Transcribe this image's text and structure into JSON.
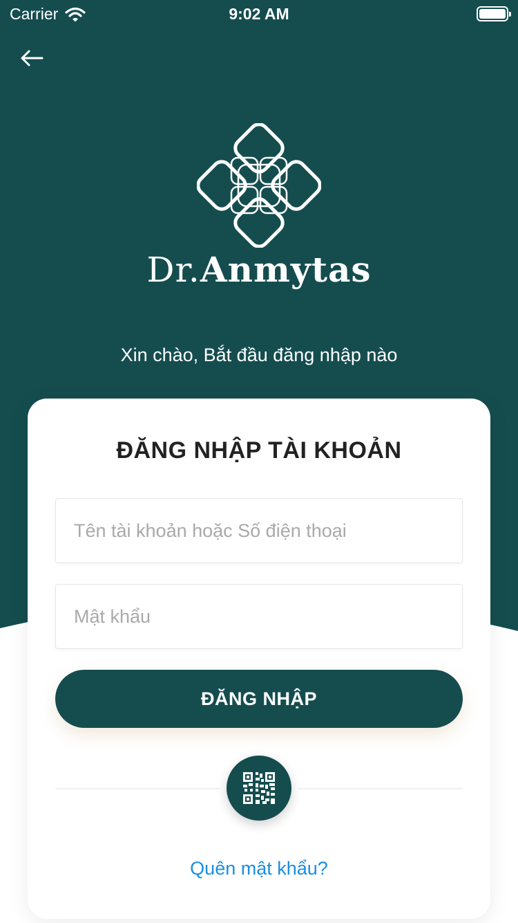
{
  "status_bar": {
    "carrier": "Carrier",
    "time": "9:02 AM"
  },
  "brand": {
    "prefix": "Dr.",
    "name": "Anmytas"
  },
  "greeting": "Xin chào, Bắt đầu đăng nhập nào",
  "login_card": {
    "title": "ĐĂNG NHẬP TÀI KHOẢN",
    "username_placeholder": "Tên tài khoản hoặc Số điện thoại",
    "password_placeholder": "Mật khẩu",
    "login_button": "ĐĂNG NHẬP",
    "forgot_password": "Quên mật khẩu?"
  },
  "colors": {
    "primary": "#154d4f",
    "link": "#1a8ee0",
    "background": "#ffffff"
  },
  "icons": [
    "wifi-icon",
    "battery-icon",
    "back-arrow-icon",
    "logo-icon",
    "qr-code-icon"
  ]
}
